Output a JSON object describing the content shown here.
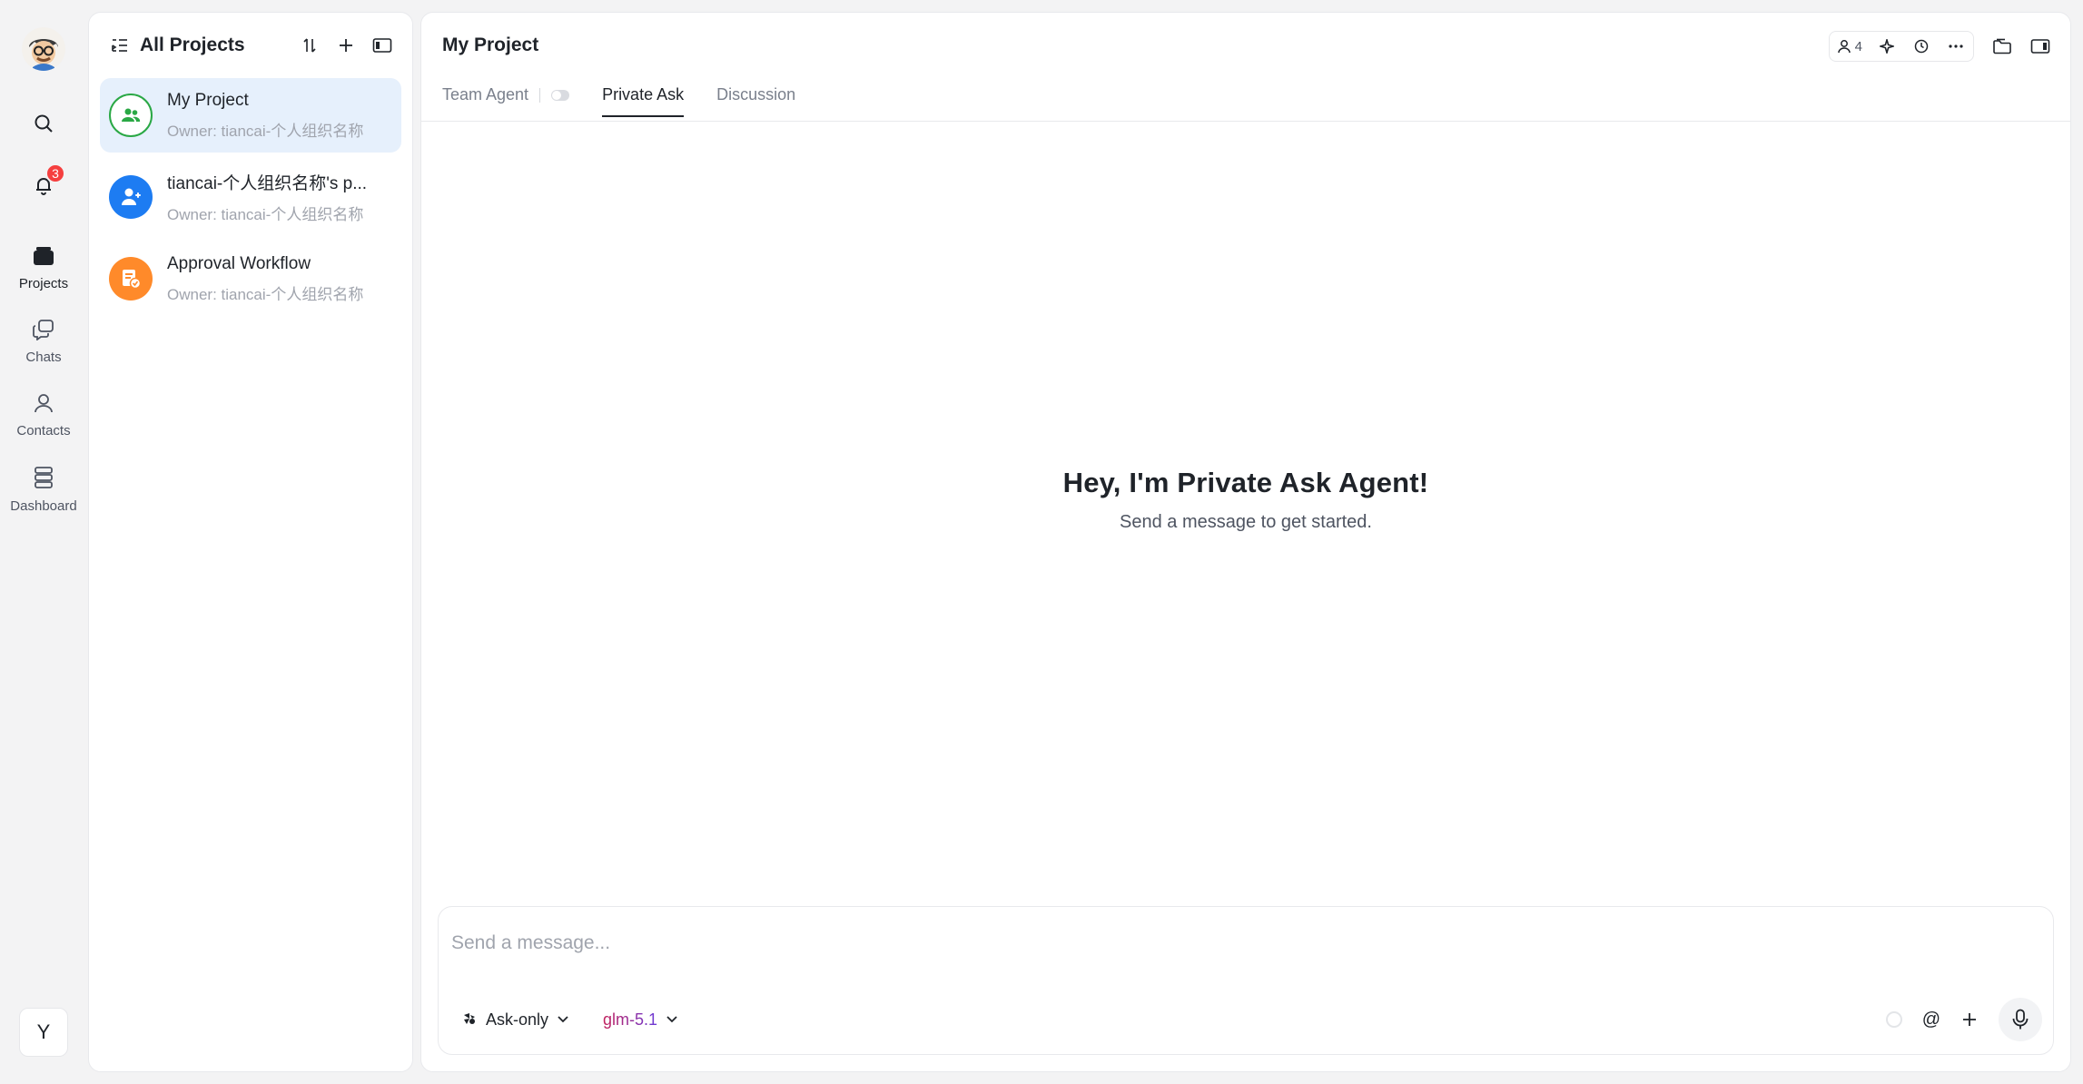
{
  "rail": {
    "notification_count": "3",
    "nav": [
      {
        "label": "Projects",
        "icon": "folder-icon",
        "active": true
      },
      {
        "label": "Chats",
        "icon": "chat-bubbles-icon",
        "active": false
      },
      {
        "label": "Contacts",
        "icon": "person-icon",
        "active": false
      },
      {
        "label": "Dashboard",
        "icon": "stack-icon",
        "active": false
      }
    ],
    "user_initial": "Y"
  },
  "projects_panel": {
    "title": "All Projects",
    "items": [
      {
        "name": "My Project",
        "owner": "Owner: tiancai-个人组织名称",
        "icon_color": "#2aa845",
        "icon": "team-icon"
      },
      {
        "name": "tiancai-个人组织名称's p...",
        "owner": "Owner: tiancai-个人组织名称",
        "icon_color": "#1d7cf2",
        "icon": "add-user-icon"
      },
      {
        "name": "Approval Workflow",
        "owner": "Owner: tiancai-个人组织名称",
        "icon_color": "#ff8a2a",
        "icon": "approval-doc-icon"
      }
    ]
  },
  "main": {
    "title": "My Project",
    "member_count": "4",
    "tabs": [
      {
        "label": "Team Agent"
      },
      {
        "label": "Private Ask"
      },
      {
        "label": "Discussion"
      }
    ],
    "active_tab": "Private Ask",
    "empty_title": "Hey, I'm Private Ask Agent!",
    "empty_subtitle": "Send a message to get started."
  },
  "composer": {
    "placeholder": "Send a message...",
    "mode": "Ask-only",
    "model": "glm-5.1",
    "mention_symbol": "@"
  }
}
